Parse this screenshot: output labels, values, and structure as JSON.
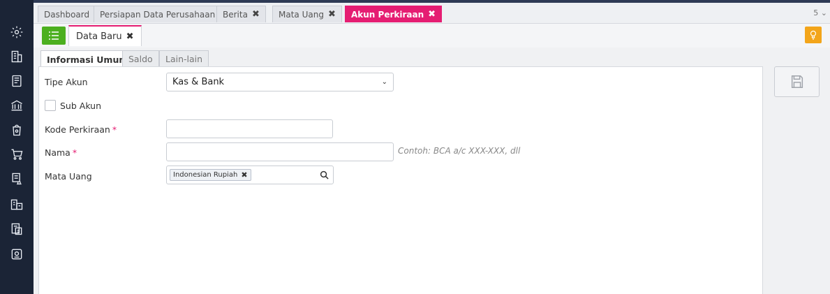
{
  "top_tabs": [
    {
      "label": "Dashboard",
      "closable": false
    },
    {
      "label": "Persiapan Data Perusahaan",
      "closable": false
    },
    {
      "label": "Berita",
      "closable": true
    },
    {
      "label": "Mata Uang",
      "closable": true
    },
    {
      "label": "Akun Perkiraan",
      "closable": true,
      "active": true
    }
  ],
  "top_tab_count": "5",
  "document_tab": {
    "label": "Data Baru"
  },
  "form_tabs": [
    {
      "label": "Informasi Umum",
      "active": true
    },
    {
      "label": "Saldo"
    },
    {
      "label": "Lain-lain"
    }
  ],
  "form": {
    "tipe_akun_label": "Tipe Akun",
    "tipe_akun_value": "Kas & Bank",
    "sub_akun_label": "Sub Akun",
    "kode_label": "Kode Perkiraan",
    "nama_label": "Nama",
    "required_mark": "*",
    "nama_hint": "Contoh: BCA a/c XXX-XXX, dll",
    "mata_uang_label": "Mata Uang",
    "mata_uang_tag": "Indonesian Rupiah"
  },
  "colors": {
    "sidebar": "#1b2436",
    "accent": "#e51d72",
    "menu_button": "#4caf1f",
    "bulb_button": "#f3a51a"
  },
  "sidebar_icons": [
    "settings-icon",
    "company-icon",
    "ledger-icon",
    "bank-icon",
    "sales-icon",
    "purchase-icon",
    "inventory-icon",
    "assets-icon",
    "reports-icon",
    "cashier-icon"
  ]
}
